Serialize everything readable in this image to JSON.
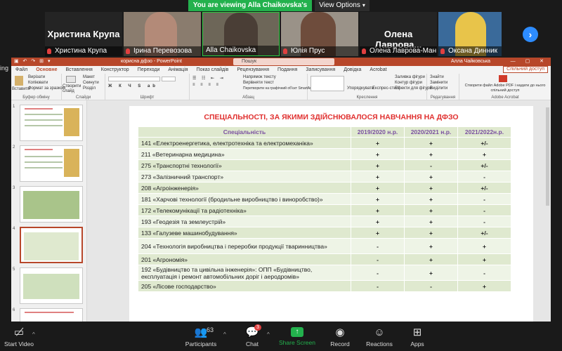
{
  "banner": {
    "text": "You are viewing Alla Chaikovska's screen",
    "view_options": "View Options"
  },
  "participants": {
    "tiles": [
      {
        "big_name": "Христина Крупа",
        "label": "Христина Крупа",
        "video": false
      },
      {
        "big_name": "",
        "label": "Ірина Перевозова",
        "video": true
      },
      {
        "big_name": "",
        "label": "Alla Chaikovska",
        "video": true,
        "active": true
      },
      {
        "big_name": "",
        "label": "Юлія Прус",
        "video": true
      },
      {
        "big_name": "Олена Лаврова...",
        "label": "Олена Лаврова-Ман...",
        "video": false
      },
      {
        "big_name": "",
        "label": "Оксана Динник",
        "video": true
      }
    ],
    "left_fragment": "ing"
  },
  "ppt": {
    "title": "корисна дфзо  -  PowerPoint",
    "search_placeholder": "Пошук",
    "user": "Алла Чайковська",
    "share_btn": "Спільний доступ",
    "tabs": [
      "Файл",
      "Основне",
      "Вставлення",
      "Конструктор",
      "Переходи",
      "Анімація",
      "Показ слайдів",
      "Рецензування",
      "Подання",
      "Записування",
      "Довідка",
      "Acrobat"
    ],
    "active_tab": "Основне",
    "ribbon_groups": [
      "Буфер обміну",
      "Слайди",
      "Шрифт",
      "Абзац",
      "Креслення",
      "Редагування",
      "Adobe Acrobat"
    ],
    "ribbon_items": {
      "paste": "Вставити",
      "cut": "Вирізати",
      "copy": "Копіювати",
      "format": "Формат за зразком",
      "new_slide": "Створити слайд",
      "layout": "Макет",
      "reset": "Скинути",
      "section": "Розділ",
      "text_dir": "Напрямок тексту",
      "align_text": "Вирівняти текст",
      "smartart": "Перетворити на графічний об'єкт SmartArt",
      "arrange": "Упорядкувати",
      "quick_styles": "Експрес-стилі",
      "fill": "Заливка фігури",
      "outline": "Контур фігури",
      "effects": "Ефекти для фігури",
      "find": "Знайти",
      "replace": "Замінити",
      "select": "Виділити",
      "acrobat": "Створити файл Adobe PDF і надати до нього спільний доступ"
    },
    "thumbnails": [
      "1",
      "2",
      "3",
      "4",
      "5",
      "6"
    ],
    "selected_thumb": "4"
  },
  "slide": {
    "title": "СПЕЦІАЛЬНОСТІ, ЗА ЯКИМИ ЗДІЙСНЮВАЛОСЯ НАВЧАННЯ НА ДФЗО",
    "headers": [
      "Спеціальність",
      "2019/2020 н.р.",
      "2020/2021 н.р.",
      "2021/2022н.р."
    ],
    "rows": [
      [
        "141 «Електроенергетика, електротехніка та електромеханіка»",
        "+",
        "+",
        "+/-"
      ],
      [
        "211 «Ветеринарна медицина»",
        "+",
        "+",
        "+"
      ],
      [
        "275 «Транспортні технології»",
        "+",
        "-",
        "+/-"
      ],
      [
        "273 «Залізничний транспорт»",
        "+",
        "+",
        "-"
      ],
      [
        "208 «Агроінженерія»",
        "+",
        "+",
        "+/-"
      ],
      [
        "181 «Харчові технології (бродильне виробництво і виноробство)»",
        "+",
        "+",
        "-"
      ],
      [
        "172 «Телекомунікації та радіотехніка»",
        "+",
        "+",
        "-"
      ],
      [
        "193 «Геодезія та землеустрій»",
        "+",
        "+",
        "-"
      ],
      [
        "133 «Галузеве машинобудування»",
        "+",
        "+",
        "+/-"
      ],
      [
        "204 «Технологія виробництва і переробки продукції тваринництва»",
        "-",
        "+",
        "+"
      ],
      [
        "201 «Агрономія»",
        "-",
        "+",
        "+"
      ],
      [
        "192 «Будівництво та цивільна інженерія»: ОПП «Будівництво, експлуатація і ремонт автомобільних доріг і аеродромів»",
        "-",
        "+",
        "-"
      ],
      [
        "205 «Лісове господарство»",
        "-",
        "-",
        "+"
      ]
    ]
  },
  "toolbar": {
    "start_video": "Start Video",
    "participants": "Participants",
    "participants_count": "63",
    "chat": "Chat",
    "chat_badge": "3",
    "share_screen": "Share Screen",
    "record": "Record",
    "reactions": "Reactions",
    "apps": "Apps"
  }
}
